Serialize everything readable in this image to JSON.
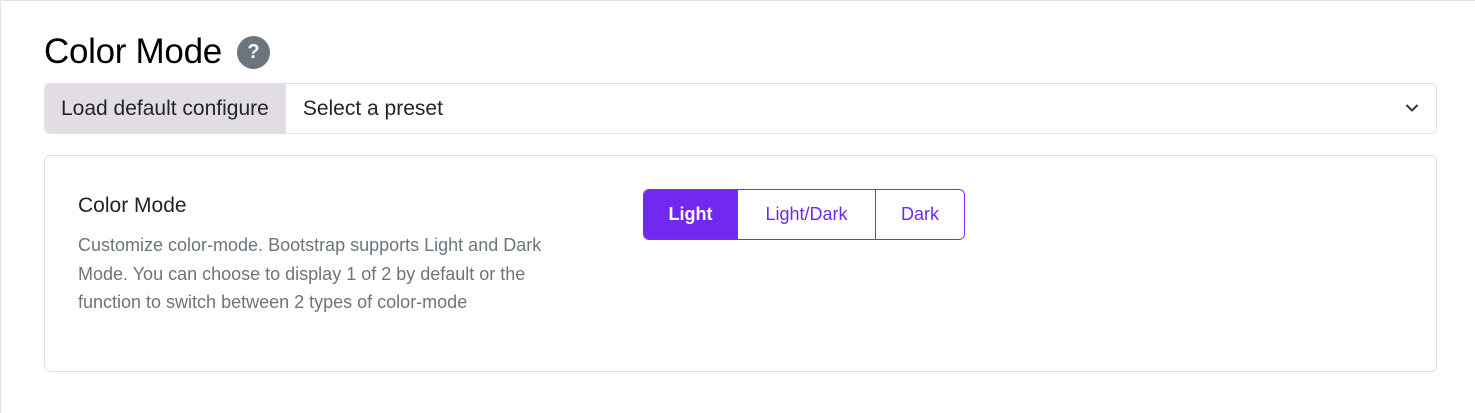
{
  "header": {
    "title": "Color Mode",
    "help_glyph": "?",
    "help_icon": "question-circle-icon"
  },
  "preset": {
    "label": "Load default configure",
    "selected": "Select a preset",
    "dropdown_icon": "chevron-down-icon"
  },
  "setting": {
    "title": "Color Mode",
    "description": "Customize color-mode. Bootstrap supports Light and Dark Mode. You can choose to display 1 of 2 by default or the function to switch between 2 types of color-mode",
    "options": [
      {
        "label": "Light",
        "active": true
      },
      {
        "label": "Light/Dark",
        "active": false
      },
      {
        "label": "Dark",
        "active": false
      }
    ]
  },
  "colors": {
    "accent": "#7129ef",
    "label_bg": "#e2dde4",
    "muted_text": "#6c757d",
    "border": "#dee2e6"
  }
}
